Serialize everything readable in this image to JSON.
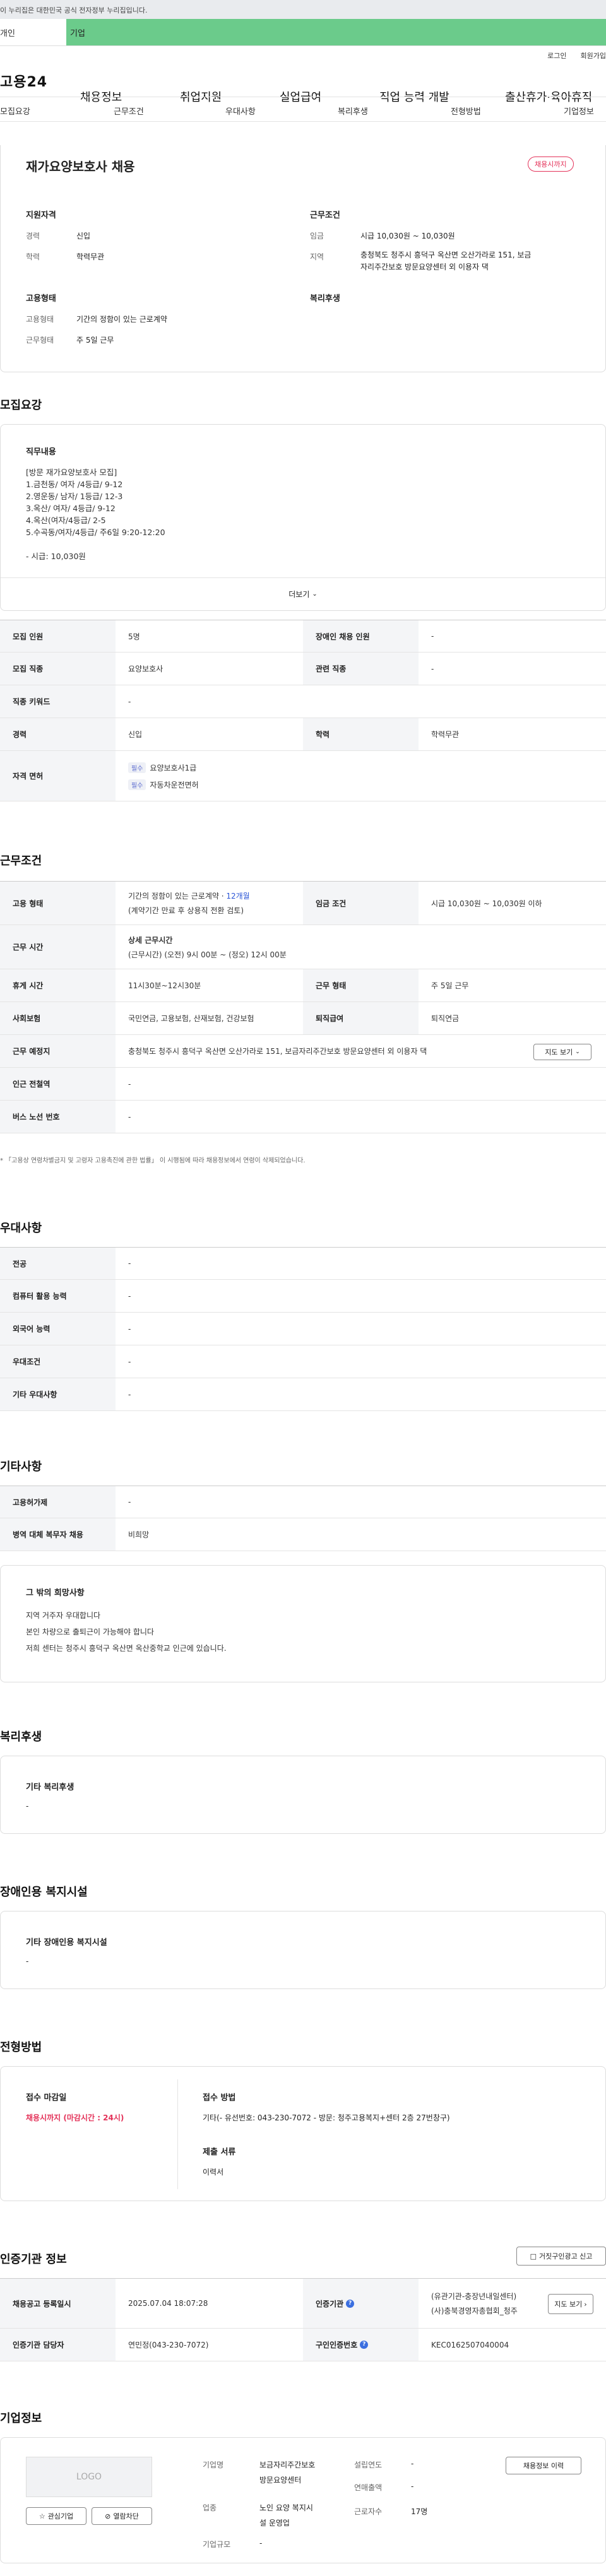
{
  "gov_banner": "이 누리집은 대한민국 공식 전자정부 누리집입니다.",
  "user_tabs": {
    "individual": "개인",
    "corporate": "기업"
  },
  "top_links": {
    "login": "로그인",
    "signup": "회원가입"
  },
  "gnb": {
    "logo": "고용24",
    "menu": [
      "채용정보",
      "취업지원",
      "실업급여",
      "직업 능력 개발",
      "출산휴가·육아휴직"
    ]
  },
  "subnav": [
    "모집요강",
    "근무조건",
    "우대사항",
    "복리후생",
    "전형방법",
    "기업정보"
  ],
  "job": {
    "title": "재가요양보호사 채용",
    "status_badge": "채용시까지",
    "summary": {
      "qual_title": "지원자격",
      "career_label": "경력",
      "career": "신입",
      "edu_label": "학력",
      "edu": "학력무관",
      "work_title": "근무조건",
      "wage_label": "임금",
      "wage": "시급 10,030원 ~ 10,030원",
      "loc_label": "지역",
      "loc_line1": "충청북도 청주시 흥덕구 옥산면 오산가라로 151, 보금",
      "loc_line2": "자리주간보호 방문요양센터 외 이용자 댁",
      "emp_title": "고용형태",
      "emp_type_label": "고용형태",
      "emp_type": "기간의 정함이 있는 근로계약",
      "work_form_label": "근무형태",
      "work_form": "주 5일 근무",
      "welfare_title": "복리후생"
    }
  },
  "recruit": {
    "section": "모집요강",
    "duty_title": "직무내용",
    "duty_lines": [
      "[방문 재가요양보호사 모집]",
      "1.금천동/ 여자 /4등급/ 9-12",
      "2.영운동/ 남자/ 1등급/ 12-3",
      "3.옥산/ 여자/ 4등급/ 9-12",
      "4.옥산(여자/4등급/ 2-5",
      "5.수곡동/여자/4등급/ 주6일 9:20-12:20",
      "",
      "- 시급: 10,030원"
    ],
    "more": "더보기",
    "rows": [
      {
        "h1": "모집 인원",
        "v1": "5명",
        "h2": "장애인 채용 인원",
        "v2": "-"
      },
      {
        "h1": "모집 직종",
        "v1": "요양보호사",
        "h2": "관련 직종",
        "v2": "-"
      },
      {
        "h1": "직종 키워드",
        "v1": "-"
      },
      {
        "h1": "경력",
        "v1": "신입",
        "h2": "학력",
        "v2": "학력무관"
      }
    ],
    "license_label": "자격 면허",
    "pill": "필수",
    "licenses": [
      "요양보호사1급",
      "자동차운전면허"
    ]
  },
  "conditions": {
    "section": "근무조건",
    "emp_label": "고용 형태",
    "emp_v1": "기간의 정함이 있는 근로계약 · ",
    "emp_period": "12개월",
    "emp_v2": "(계약기간 만료 후 상용직 전환 검토)",
    "wage_label": "임금 조건",
    "wage": "시급 10,030원 ~ 10,030원 이하",
    "time_label": "근무 시간",
    "time_title": "상세 근무시간",
    "time_v": "(근무시간) (오전) 9시 00분 ~ (정오) 12시 00분",
    "break_label": "휴게 시간",
    "break_v": "11시30분~12시30분",
    "form_label": "근무 형태",
    "form_v": "주 5일 근무",
    "ins_label": "사회보험",
    "ins_v": "국민연금, 고용보험, 산재보험, 건강보험",
    "ret_label": "퇴직급여",
    "ret_v": "퇴직연금",
    "place_label": "근무 예정지",
    "place_v": "충청북도 청주시 흥덕구 옥산면 오산가라로 151, 보금자리주간보호 방문요양센터 외 이용자 댁",
    "map_btn": "지도 보기",
    "subway_label": "인근 전철역",
    "subway_v": "-",
    "bus_label": "버스 노선 번호",
    "bus_v": "-",
    "note": "* 「고용상 연령차별금지 및 고령자 고용촉진에 관한 법률」 이 시행됨에 따라 채용정보에서 연령이 삭제되었습니다."
  },
  "preference": {
    "section": "우대사항",
    "rows": [
      [
        "전공",
        "-"
      ],
      [
        "컴퓨터 활용 능력",
        "-"
      ],
      [
        "외국어 능력",
        "-"
      ],
      [
        "우대조건",
        "-"
      ],
      [
        "기타 우대사항",
        "-"
      ]
    ]
  },
  "etc": {
    "section": "기타사항",
    "rows": [
      [
        "고용허가제",
        "-"
      ],
      [
        "병역 대체 복무자 채용",
        "비희망"
      ]
    ],
    "wish_title": "그 밖의 희망사항",
    "wish_lines": [
      "지역 거주자 우대합니다",
      "본인 차량으로 출퇴근이 가능해야 합니다",
      "저희 센터는 청주시 흥덕구 옥산면 옥산중학교 인근에 있습니다."
    ]
  },
  "welfare": {
    "section": "복리후생",
    "title": "기타 복리후생",
    "value": "-"
  },
  "disabled": {
    "section": "장애인용 복지시설",
    "title": "기타 장애인용 복지시설",
    "value": "-"
  },
  "screening": {
    "section": "전형방법",
    "deadline_title": "접수 마감일",
    "deadline": "채용시까지 (마감시간 : 24시)",
    "method_title": "접수 방법",
    "method": "기타(- 유선번호: 043-230-7072 - 방문: 청주고용복지+센터 2층 27번창구)",
    "docs_title": "제출 서류",
    "docs": "이력서"
  },
  "agency": {
    "section": "인증기관 정보",
    "report_btn": "거짓구인광고 신고",
    "reg_label": "채용공고 등록일시",
    "reg_v": "2025.07.04 18:07:28",
    "agency_label": "인증기관",
    "agency_v1": "(유관기관-충장년내일센터)",
    "agency_v2": "(사)충북경영자총협회_청주",
    "map_btn": "지도 보기",
    "staff_label": "인증기관 담당자",
    "staff_v": "연민정(043-230-7072)",
    "notice_label": "구인인증번호",
    "notice_v": "KEC0162507040004"
  },
  "company": {
    "section": "기업정보",
    "logo": "LOGO",
    "fav_btn": "관심기업",
    "block_btn": "열람차단",
    "name_label": "기업명",
    "name_v1": "보금자리주간보호",
    "name_v2": "방문요양센터",
    "founded_label": "설립연도",
    "founded_v": "-",
    "sales_label": "연매출액",
    "sales_v": "-",
    "biz_label": "업종",
    "biz_v1": "노인 요양 복지시",
    "biz_v2": "설 운영업",
    "emp_label": "근로자수",
    "emp_v": "17명",
    "scale_label": "기업규모",
    "scale_v": "-",
    "hist_btn": "채용정보 이력"
  }
}
